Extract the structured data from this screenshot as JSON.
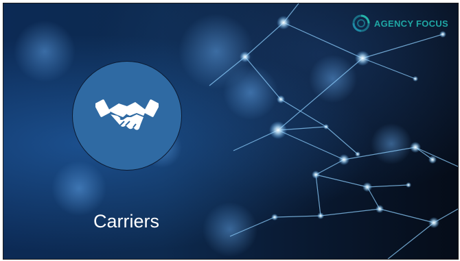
{
  "brand": {
    "name": "AGENCY FOCUS",
    "color": "#1fa7a4"
  },
  "slide": {
    "title": "Carriers",
    "icon": "handshake-icon",
    "circle_color": "#2f6aa3",
    "background": "#0c2a55"
  }
}
